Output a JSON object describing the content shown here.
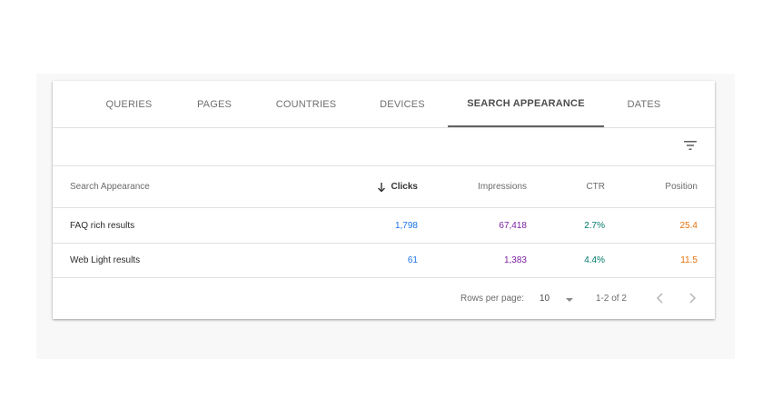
{
  "tabs": [
    {
      "label": "QUERIES"
    },
    {
      "label": "PAGES"
    },
    {
      "label": "COUNTRIES"
    },
    {
      "label": "DEVICES"
    },
    {
      "label": "SEARCH APPEARANCE",
      "active": true
    },
    {
      "label": "DATES"
    }
  ],
  "table": {
    "headers": {
      "name": "Search Appearance",
      "clicks": "Clicks",
      "impressions": "Impressions",
      "ctr": "CTR",
      "position": "Position"
    },
    "sort_column": "clicks",
    "sort_direction": "descending",
    "rows": [
      {
        "name": "FAQ rich results",
        "clicks": "1,798",
        "impressions": "67,418",
        "ctr": "2.7%",
        "position": "25.4"
      },
      {
        "name": "Web Light results",
        "clicks": "61",
        "impressions": "1,383",
        "ctr": "4.4%",
        "position": "11.5"
      }
    ]
  },
  "footer": {
    "rows_per_page_label": "Rows per page:",
    "rows_per_page_value": "10",
    "range_text": "1-2 of 2"
  },
  "icons": {
    "filter": "filter-icon",
    "sort": "arrow-down-icon",
    "dropdown": "dropdown-triangle-icon",
    "prev": "chevron-left-icon",
    "next": "chevron-right-icon"
  },
  "colors": {
    "clicks": "#1a73e8",
    "impressions": "#7b1fa2",
    "ctr": "#00796b",
    "position": "#e8710a",
    "active_tab_indicator": "#616161"
  }
}
